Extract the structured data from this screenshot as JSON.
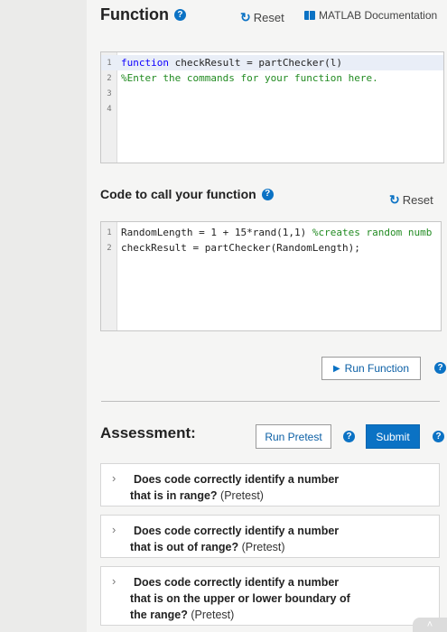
{
  "function_section": {
    "title": "Function",
    "reset_label": "Reset",
    "doc_label": "MATLAB Documentation",
    "lines": [
      {
        "num": "1",
        "kw": "function",
        "rest": " checkResult = partChecker(l)",
        "comment": ""
      },
      {
        "num": "2",
        "kw": "",
        "rest": "",
        "comment": "%Enter the commands for your function here."
      },
      {
        "num": "3",
        "kw": "",
        "rest": "",
        "comment": ""
      },
      {
        "num": "4",
        "kw": "",
        "rest": "",
        "comment": ""
      }
    ]
  },
  "call_section": {
    "title": "Code to call your function",
    "reset_label": "Reset",
    "lines": [
      {
        "num": "1",
        "code": "RandomLength = 1 + 15*rand(1,1) ",
        "comment": "%creates random numb"
      },
      {
        "num": "2",
        "code": "checkResult = partChecker(RandomLength);",
        "comment": ""
      }
    ],
    "run_label": "Run Function"
  },
  "assessment": {
    "title": "Assessment:",
    "run_pretest_label": "Run Pretest",
    "submit_label": "Submit",
    "tests": [
      {
        "lines": [
          "Does code correctly identify a number"
        ],
        "tail": "that is in range?",
        "tag": "(Pretest)"
      },
      {
        "lines": [
          "Does code correctly identify a number"
        ],
        "tail": "that is out of range?",
        "tag": "(Pretest)"
      },
      {
        "lines": [
          "Does code correctly identify a number",
          "that is on the upper or lower boundary of"
        ],
        "tail": "the range?",
        "tag": "(Pretest)"
      }
    ]
  },
  "colors": {
    "accent": "#0b72c4",
    "keyword": "#0e00ff",
    "comment": "#228b22"
  },
  "icons": {
    "help": "question-circle-icon",
    "reset": "circular-arrow-icon",
    "doc": "book-icon",
    "run": "play-triangle-icon",
    "expand": "chevron-right-icon"
  }
}
